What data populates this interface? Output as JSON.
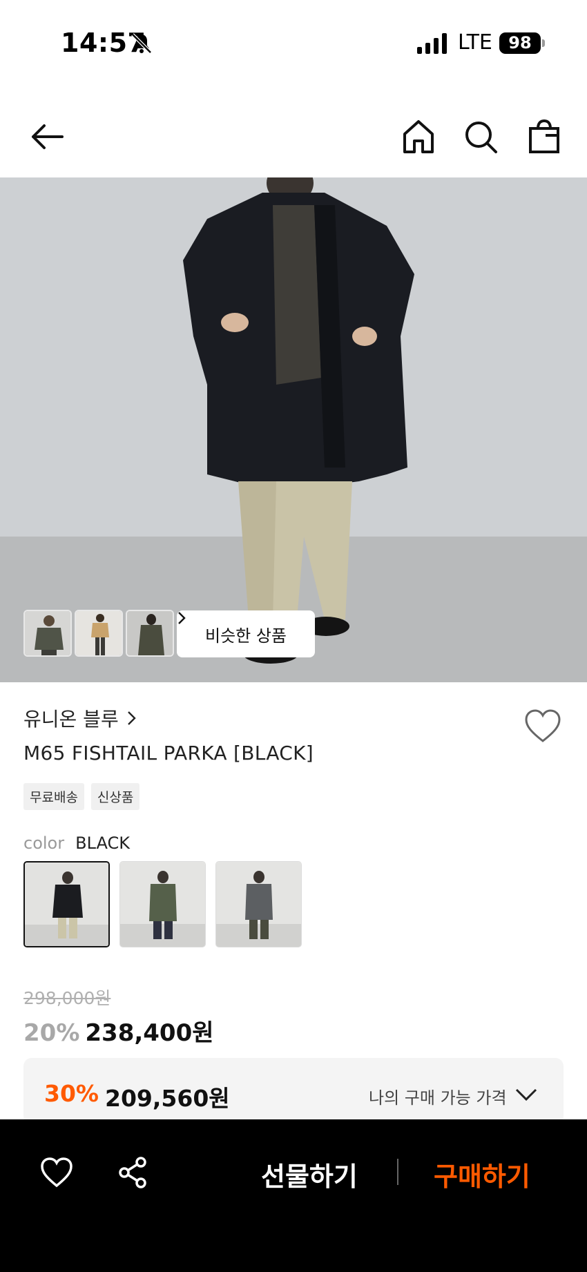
{
  "status": {
    "time": "14:57",
    "network": "LTE",
    "battery": "98"
  },
  "hero": {
    "similar_label": "비슷한 상품"
  },
  "product": {
    "brand": "유니온 블루",
    "name": "M65 FISHTAIL PARKA [BLACK]",
    "tags": [
      "무료배송",
      "신상품"
    ],
    "color_key": "color",
    "color_value": "BLACK",
    "original_price": "298,000원",
    "discount": "20%",
    "price": "238,400원"
  },
  "my_price": {
    "discount": "30%",
    "price": "209,560원",
    "label": "나의 구매 가능 가격"
  },
  "bottom_bar": {
    "gift_label": "선물하기",
    "buy_label": "구매하기"
  },
  "colors": {
    "accent": "#ff5a00",
    "bottom_bar_bg": "#000000"
  }
}
